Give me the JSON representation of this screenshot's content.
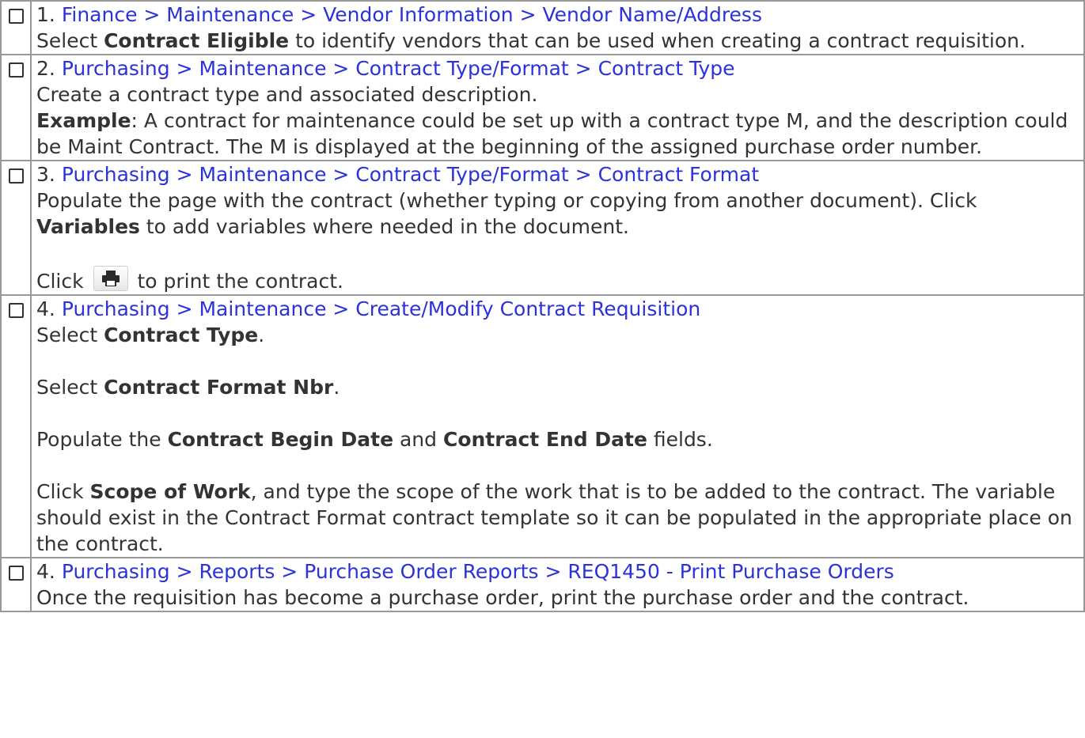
{
  "steps": [
    {
      "number": "1.",
      "path": "Finance > Maintenance > Vendor Information > Vendor Name/Address",
      "select_prefix": "Select ",
      "bold": "Contract Eligible",
      "rest": " to identify vendors that can be used when creating a contract requisition."
    },
    {
      "number": "2.",
      "path": "Purchasing > Maintenance > Contract Type/Format > Contract Type",
      "line1": "Create a contract type and associated description.",
      "example_label": "Example",
      "example_text": ": A contract for maintenance could be set up with a contract type M, and the description could be Maint Contract. The M is displayed at the beginning of the assigned purchase order number."
    },
    {
      "number": "3.",
      "path": "Purchasing > Maintenance > Contract Type/Format > Contract Format",
      "line1": "Populate the page with the contract (whether typing or copying from another document). Click ",
      "bold": "Variables",
      "line1_rest": " to add variables where needed in the document.",
      "click": "Click ",
      "print_icon": "printer-icon",
      "print_rest": " to print the contract."
    },
    {
      "number": "4.",
      "path": "Purchasing > Maintenance > Create/Modify Contract Requisition",
      "select": "Select ",
      "contract_type": "Contract Type",
      "period": ".",
      "contract_format_nbr": "Contract Format Nbr",
      "populate": "Populate the ",
      "begin_date": "Contract Begin Date",
      "and": " and ",
      "end_date": "Contract End Date",
      "fields": " fields.",
      "click": "Click ",
      "scope_of_work": "Scope of Work",
      "scope_rest": ", and type the scope of the work that is to be added to the contract. The variable should exist in the Contract Format contract template so it can be populated in the appropriate place on the contract."
    },
    {
      "number": "4.",
      "path": "Purchasing > Reports > Purchase Order Reports > REQ1450 - Print Purchase Orders",
      "text": "Once the requisition has become a purchase order, print the purchase order and the contract."
    }
  ]
}
